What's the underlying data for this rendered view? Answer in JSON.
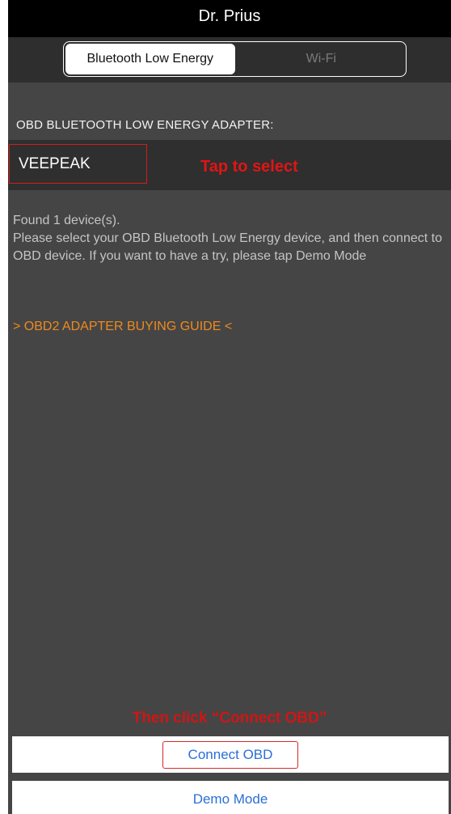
{
  "header": {
    "title": "Dr. Prius"
  },
  "segmented": {
    "options": [
      "Bluetooth Low Energy",
      "Wi-Fi"
    ],
    "selected": "Bluetooth Low Energy"
  },
  "adapter": {
    "section_label": "OBD BLUETOOTH LOW ENERGY ADAPTER:",
    "selected_device": "VEEPEAK",
    "tap_hint": "Tap to select"
  },
  "info": {
    "found": "Found 1 device(s).",
    "instructions": "Please select your OBD Bluetooth Low Energy device, and then connect to OBD device. If you want to have a try, please tap Demo Mode",
    "buying_guide": "> OBD2 ADAPTER BUYING GUIDE <"
  },
  "footer": {
    "connect_hint": "Then click “Connect OBD”",
    "connect_label": "Connect OBD",
    "demo_label": "Demo Mode"
  },
  "colors": {
    "background": "#454545",
    "accent_link": "#2a6fd6",
    "guide": "#ee8a1f",
    "annotation_red": "#e31414"
  }
}
